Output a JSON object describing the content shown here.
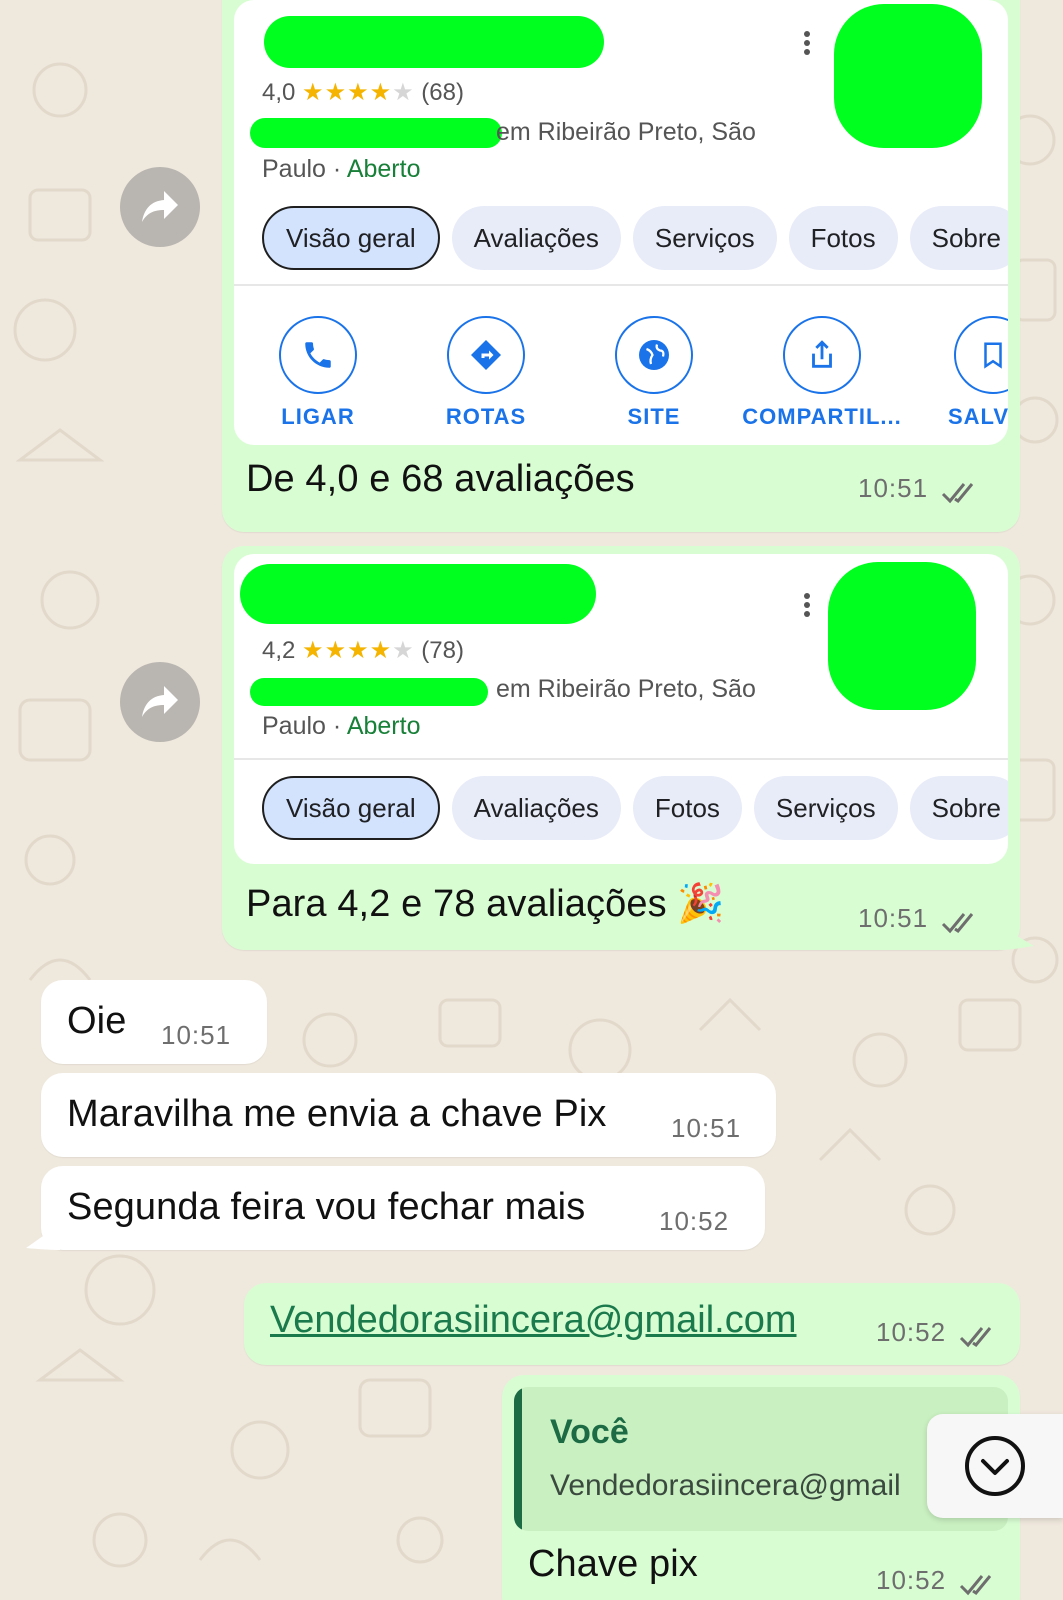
{
  "colors": {
    "outgoing_bubble": "#d9fdd3",
    "incoming_bubble": "#ffffff",
    "chat_background": "#efe8dd",
    "maps_blue": "#1a73e8",
    "open_green": "#188038",
    "redaction": "#00ff1f"
  },
  "card1": {
    "rating": "4,0",
    "stars_filled": 4,
    "reviews": "(68)",
    "location": "em Ribeirão Preto, São",
    "location_cont": "Paulo",
    "separator": "·",
    "status": "Aberto",
    "tabs": [
      "Visão geral",
      "Avaliações",
      "Serviços",
      "Fotos",
      "Sobre"
    ],
    "actions": [
      {
        "label": "LIGAR",
        "icon": "phone-icon"
      },
      {
        "label": "ROTAS",
        "icon": "directions-icon"
      },
      {
        "label": "SITE",
        "icon": "globe-icon"
      },
      {
        "label": "COMPARTIL...",
        "icon": "share-icon"
      },
      {
        "label": "SALV",
        "icon": "bookmark-icon"
      }
    ]
  },
  "message1": {
    "text": "De 4,0 e 68 avaliações",
    "time": "10:51"
  },
  "card2": {
    "rating": "4,2",
    "stars_filled": 4,
    "reviews": "(78)",
    "location": "em Ribeirão Preto, São",
    "location_cont": "Paulo",
    "separator": "·",
    "status": "Aberto",
    "tabs": [
      "Visão geral",
      "Avaliações",
      "Fotos",
      "Serviços",
      "Sobre"
    ]
  },
  "message2": {
    "text": "Para 4,2 e 78 avaliações",
    "emoji": "🎉",
    "time": "10:51"
  },
  "incoming": [
    {
      "text": "Oie",
      "time": "10:51"
    },
    {
      "text": "Maravilha me envia a chave Pix",
      "time": "10:51"
    },
    {
      "text": "Segunda feira vou fechar mais",
      "time": "10:52"
    }
  ],
  "message3": {
    "text": "Vendedorasiincera@gmail.com",
    "time": "10:52"
  },
  "message4": {
    "quote_author": "Você",
    "quote_text": "Vendedorasiincera@gmail",
    "text": "Chave pix",
    "time": "10:52"
  }
}
